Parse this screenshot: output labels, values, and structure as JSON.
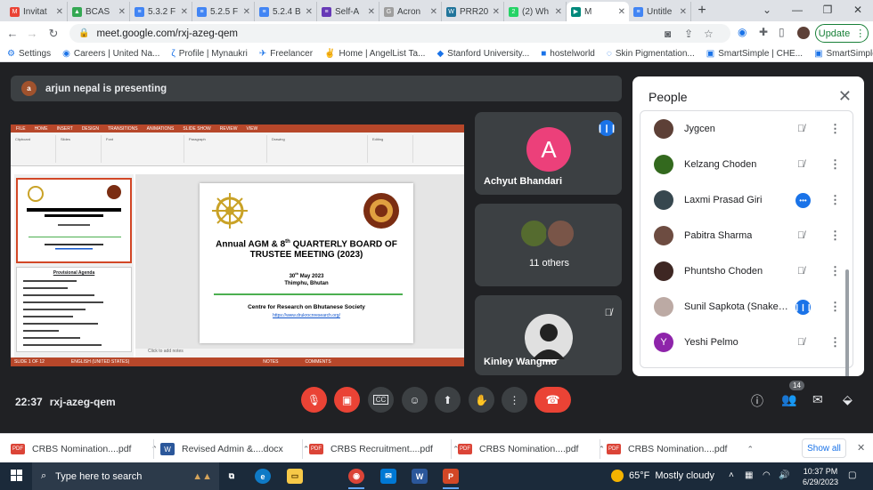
{
  "browser": {
    "tabs": [
      {
        "label": "Invitat",
        "fav_color": "#ea4335",
        "fav_text": "M",
        "active": false
      },
      {
        "label": "BCAS",
        "fav_color": "#34a853",
        "fav_text": "▲",
        "active": false
      },
      {
        "label": "5.3.2 F",
        "fav_color": "#4285f4",
        "fav_text": "≡",
        "active": false
      },
      {
        "label": "5.2.5 F",
        "fav_color": "#4285f4",
        "fav_text": "≡",
        "active": false
      },
      {
        "label": "5.2.4 B",
        "fav_color": "#4285f4",
        "fav_text": "≡",
        "active": false
      },
      {
        "label": "Self-A",
        "fav_color": "#673ab7",
        "fav_text": "≡",
        "active": false
      },
      {
        "label": "Acron",
        "fav_color": "#9e9e9e",
        "fav_text": "G",
        "active": false
      },
      {
        "label": "PRR20",
        "fav_color": "#21759b",
        "fav_text": "W",
        "active": false
      },
      {
        "label": "(2) Wh",
        "fav_color": "#25d366",
        "fav_text": "2",
        "active": false
      },
      {
        "label": "M",
        "fav_color": "#00897b",
        "fav_text": "▶",
        "active": true
      },
      {
        "label": "Untitle",
        "fav_color": "#4285f4",
        "fav_text": "≡",
        "active": false
      }
    ],
    "new_tab": "+",
    "window_controls": [
      "⌄",
      "—",
      "❐",
      "✕"
    ],
    "url": "meet.google.com/rxj-azeg-qem",
    "update_label": "Update",
    "bookmarks": [
      {
        "label": "Settings",
        "icon": "⚙"
      },
      {
        "label": "Careers | United Na...",
        "icon": "◉"
      },
      {
        "label": "Profile | Mynaukri",
        "icon": "ζ"
      },
      {
        "label": "Freelancer",
        "icon": "✈"
      },
      {
        "label": "Home | AngelList Ta...",
        "icon": "✌"
      },
      {
        "label": "Stanford University...",
        "icon": "◆"
      },
      {
        "label": "hostelworld",
        "icon": "■"
      },
      {
        "label": "Skin Pigmentation...",
        "icon": "◌"
      },
      {
        "label": "SmartSimple | CHE...",
        "icon": "▣"
      },
      {
        "label": "SmartSimple - Can...",
        "icon": "▣"
      }
    ]
  },
  "meet": {
    "presenting": "arjun nepal is presenting",
    "slide": {
      "title_part1": "Annual AGM & 8",
      "title_sup": "th",
      "title_part2": " QUARTERLY BOARD OF TRUSTEE MEETING (2023)",
      "date_day": "30",
      "date_sup": "th",
      "date_rest": " May 2023",
      "place": "Thimphu, Bhutan",
      "org": "Centre for Research on Bhutanese Society",
      "url": "https://www.drukrocnresearch.org/",
      "notes_placeholder": "Click to add notes",
      "thumb2_title": "Provisional Agenda"
    },
    "tiles": [
      {
        "name": "Achyut Bhandari",
        "initial": "A"
      },
      {
        "name": "11 others"
      },
      {
        "name": "Kinley Wangmo"
      }
    ],
    "meeting_time": "22:37",
    "meeting_code": "rxj-azeg-qem",
    "participant_count": "14"
  },
  "people_panel": {
    "title": "People",
    "participants": [
      {
        "name": "Jygcen",
        "status": "muted",
        "avatar_color": "#5d4037"
      },
      {
        "name": "Kelzang Choden",
        "status": "muted",
        "avatar_color": "#33691e"
      },
      {
        "name": "Laxmi Prasad Giri",
        "status": "speaking-dots",
        "avatar_color": "#37474f"
      },
      {
        "name": "Pabitra Sharma",
        "status": "muted",
        "avatar_color": "#6d4c41"
      },
      {
        "name": "Phuntsho Choden",
        "status": "muted",
        "avatar_color": "#3e2723"
      },
      {
        "name": "Sunil Sapkota (Snake Ma...",
        "status": "speaking",
        "avatar_color": "#bcaaa4"
      },
      {
        "name": "Yeshi Pelmo",
        "status": "muted",
        "avatar_color": "#8e24aa",
        "initial": "Y"
      }
    ]
  },
  "downloads": [
    {
      "label": "CRBS Nomination....pdf",
      "type": "pdf"
    },
    {
      "label": "Revised Admin &....docx",
      "type": "docx"
    },
    {
      "label": "CRBS Recruitment....pdf",
      "type": "pdf"
    },
    {
      "label": "CRBS Nomination....pdf",
      "type": "pdf"
    },
    {
      "label": "CRBS Nomination....pdf",
      "type": "pdf"
    }
  ],
  "downloads_show_all": "Show all",
  "taskbar": {
    "search_placeholder": "Type here to search",
    "weather_temp": "65°F",
    "weather_desc": "Mostly cloudy",
    "time": "10:37 PM",
    "date": "6/29/2023"
  }
}
